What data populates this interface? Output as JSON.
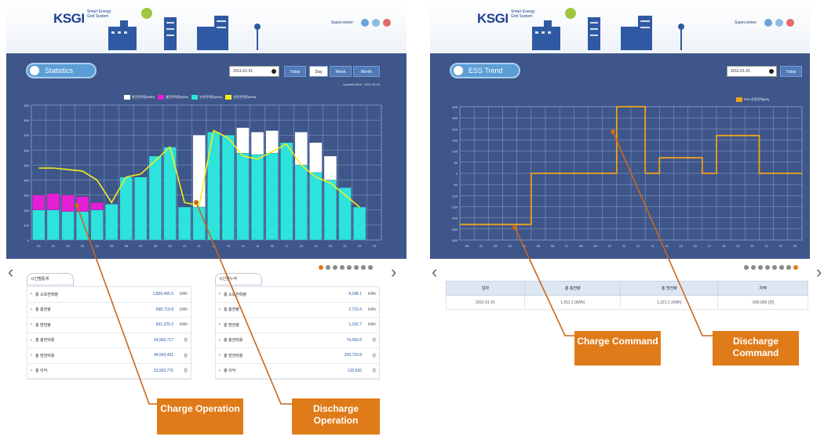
{
  "left": {
    "header": {
      "logo_main": "KSGI",
      "logo_sub": "Smart Energy Grid System",
      "header_text": "Super.owner"
    },
    "title": "Statistics",
    "date_value": "2011-01-01",
    "buttons": [
      "Today",
      "Day",
      "Week",
      "Month"
    ],
    "active_button": "Day",
    "update_text": "Updated time : 2011.06.19",
    "legend": [
      {
        "label": "발전전력량(kWh)",
        "color": "#ffffff"
      },
      {
        "label": "충전전력량(kWh)",
        "color": "#e61ed6"
      },
      {
        "label": "부하전력량(kWh)",
        "color": "#2de3dc"
      },
      {
        "label": "방전전력량(kWh)",
        "color": "#f3ef1a"
      }
    ],
    "tab_left": "시간별통계",
    "tab_right": "시간별누적",
    "stats_left": [
      {
        "label": "총 소모전력량",
        "value": "1,809,495.0",
        "unit": "kWh"
      },
      {
        "label": "총 충전량",
        "value": "598,719.8",
        "unit": "kWh"
      },
      {
        "label": "총 방전량",
        "value": "831,229.2",
        "unit": "kWh"
      },
      {
        "label": "총 충전비용",
        "value": "24,966,717",
        "unit": "원"
      },
      {
        "label": "총 방전비용",
        "value": "48,960,491",
        "unit": "원"
      },
      {
        "label": "총 이익",
        "value": "23,993,775",
        "unit": "원"
      }
    ],
    "stats_right": [
      {
        "label": "총 소모전력량",
        "value": "8,248.1",
        "unit": "kWh"
      },
      {
        "label": "총 충전량",
        "value": "2,710.4",
        "unit": "kWh"
      },
      {
        "label": "총 방전량",
        "value": "1,242.7",
        "unit": "kWh"
      },
      {
        "label": "총 충전비용",
        "value": "79,099.6",
        "unit": "원"
      },
      {
        "label": "총 방전비용",
        "value": "299,729.8",
        "unit": "원"
      },
      {
        "label": "총 이익",
        "value": "120,630",
        "unit": "원"
      }
    ]
  },
  "right": {
    "header": {
      "logo_main": "KSGI",
      "logo_sub": "Smart Energy Grid System",
      "header_text": "Super.owner"
    },
    "title": "ESS Trend",
    "date_value": "2011-01-01",
    "buttons": [
      "Today"
    ],
    "legend": [
      {
        "label": "ESS 운영전력(kW)",
        "color": "#f0a11c"
      }
    ],
    "table_headers": [
      "일자",
      "총 충전량",
      "총 방전량",
      "차액"
    ],
    "table_rows": [
      [
        "2011-01-01",
        "1,911.1 (kWh)",
        "1,321.1 (kWh)",
        "-590,000 (원)"
      ]
    ]
  },
  "callouts": {
    "charge_operation": "Charge Operation",
    "discharge_operation": "Discharge Operation",
    "charge_command": "Charge Command",
    "discharge_command": "Discharge Command"
  },
  "colors": {
    "chart_bg": "#3e5689",
    "callout": "#e07b19",
    "charge": "#e61ed6",
    "load": "#2de3dc",
    "discharge": "#f3ef1a",
    "trend": "#f0a11c"
  },
  "chart_data": [
    {
      "type": "bar",
      "title": "Statistics",
      "categories": [
        "00",
        "01",
        "02",
        "03",
        "04",
        "05",
        "06",
        "07",
        "08",
        "09",
        "10",
        "11",
        "12",
        "13",
        "14",
        "15",
        "16",
        "17",
        "18",
        "19",
        "20",
        "21",
        "22",
        "23"
      ],
      "ylim": [
        0,
        900
      ],
      "series": [
        {
          "name": "발전전력량(kWh)",
          "values": [
            0,
            0,
            0,
            0,
            0,
            0,
            0,
            0,
            0,
            0,
            0,
            700,
            700,
            0,
            750,
            720,
            730,
            0,
            720,
            650,
            560,
            0,
            0,
            0
          ]
        },
        {
          "name": "충전전력량(kWh)",
          "values": [
            300,
            310,
            300,
            290,
            250,
            0,
            0,
            0,
            0,
            0,
            0,
            0,
            0,
            0,
            0,
            0,
            0,
            0,
            0,
            0,
            0,
            0,
            0,
            0
          ]
        },
        {
          "name": "부하전력량(kWh)",
          "values": [
            200,
            200,
            190,
            190,
            200,
            240,
            420,
            420,
            560,
            620,
            220,
            220,
            720,
            700,
            580,
            570,
            580,
            650,
            500,
            450,
            400,
            350,
            220,
            0
          ]
        },
        {
          "name": "방전전력량(kWh)",
          "values": [
            480,
            480,
            470,
            460,
            400,
            250,
            420,
            440,
            530,
            620,
            250,
            230,
            730,
            680,
            560,
            540,
            590,
            640,
            500,
            420,
            380,
            300,
            220,
            0
          ]
        }
      ]
    },
    {
      "type": "line",
      "title": "ESS Trend",
      "x": [
        "00",
        "01",
        "02",
        "03",
        "04",
        "05",
        "06",
        "07",
        "08",
        "09",
        "10",
        "11",
        "12",
        "13",
        "14",
        "15",
        "16",
        "17",
        "18",
        "19",
        "20",
        "21",
        "22",
        "23"
      ],
      "ylim": [
        -300,
        300
      ],
      "series": [
        {
          "name": "ESS 운영전력(kW)",
          "values": [
            -230,
            -230,
            -230,
            -230,
            -230,
            0,
            0,
            0,
            0,
            0,
            0,
            300,
            300,
            0,
            70,
            70,
            70,
            0,
            170,
            170,
            170,
            0,
            0,
            0
          ]
        }
      ]
    }
  ]
}
